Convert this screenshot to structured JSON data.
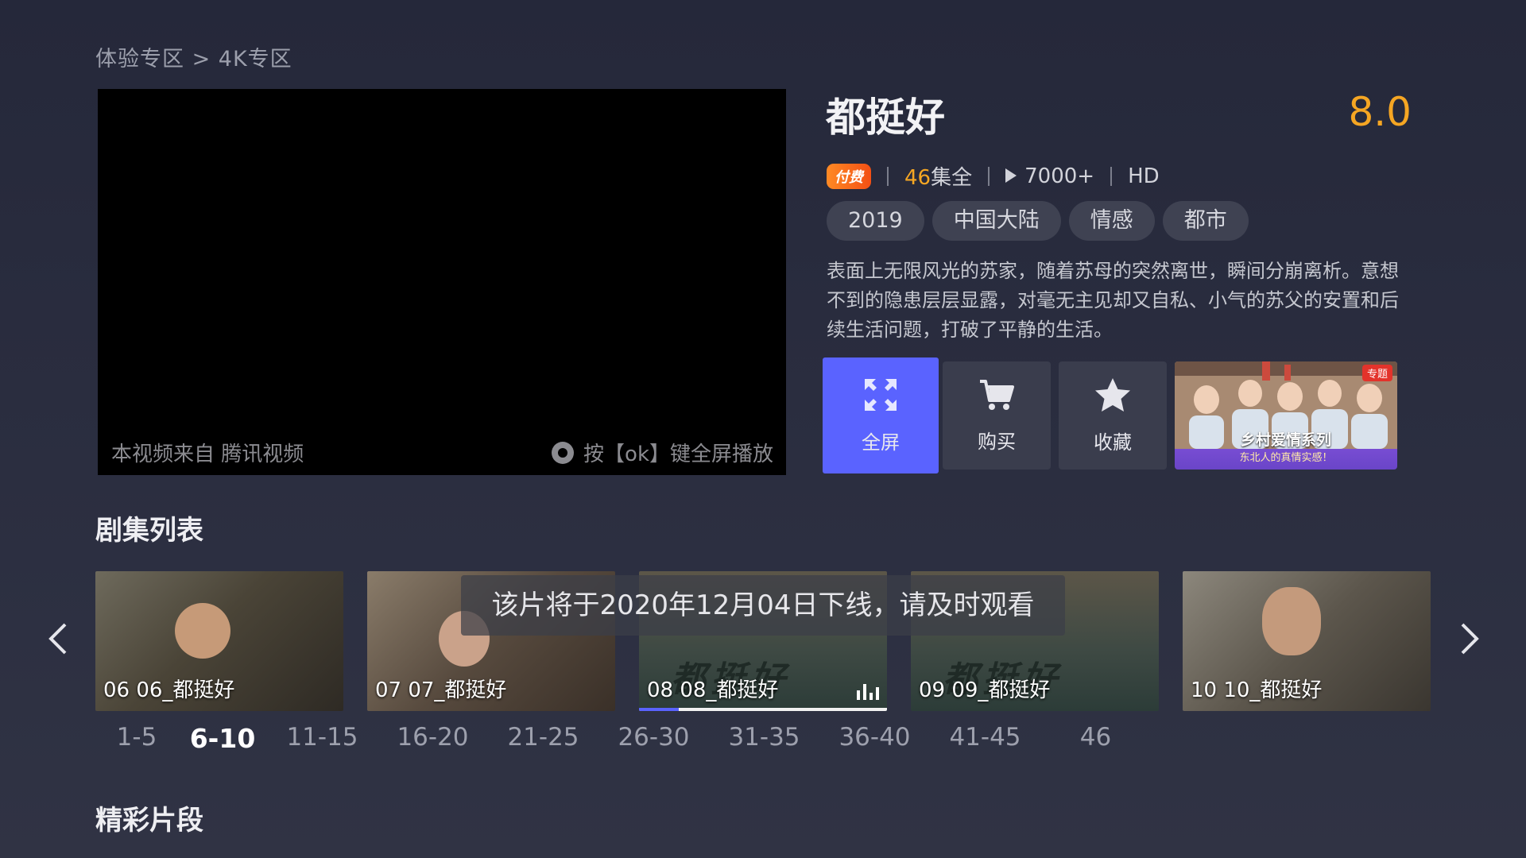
{
  "breadcrumb": "体验专区 > 4K专区",
  "player": {
    "source_text": "本视频来自 腾讯视频",
    "fullscreen_hint": "按【ok】键全屏播放"
  },
  "show": {
    "title": "都挺好",
    "score": "8.0",
    "paid_badge": "付费",
    "episode_count_num": "46",
    "episode_count_suffix": "集全",
    "play_count": "7000+",
    "quality": "HD",
    "tags": [
      "2019",
      "中国大陆",
      "情感",
      "都市"
    ],
    "description": "表面上无限风光的苏家，随着苏母的突然离世，瞬间分崩离析。意想不到的隐患层层显露，对毫无主见却又自私、小气的苏父的安置和后续生活问题，打破了平静的生活。"
  },
  "actions": {
    "fullscreen": "全屏",
    "buy": "购买",
    "favorite": "收藏"
  },
  "promo": {
    "badge": "专题",
    "title": "乡村爱情系列",
    "subtitle": "东北人的真情实感！"
  },
  "episodes_section": {
    "title": "剧集列表",
    "episodes": [
      {
        "label": "06 06_都挺好"
      },
      {
        "label": "07 07_都挺好"
      },
      {
        "label": "08 08_都挺好",
        "playing": true,
        "progress": 0.16
      },
      {
        "label": "09 09_都挺好"
      },
      {
        "label": "10 10_都挺好"
      }
    ],
    "toast": "该片将于2020年12月04日下线，请及时观看",
    "ranges": [
      "1-5",
      "6-10",
      "11-15",
      "16-20",
      "21-25",
      "26-30",
      "31-35",
      "36-40",
      "41-45",
      "46"
    ],
    "active_range": "6-10"
  },
  "clips_section": {
    "title": "精彩片段"
  },
  "colors": {
    "accent": "#5a63ff",
    "score": "#f5a623",
    "background": "#2a2d3f"
  }
}
